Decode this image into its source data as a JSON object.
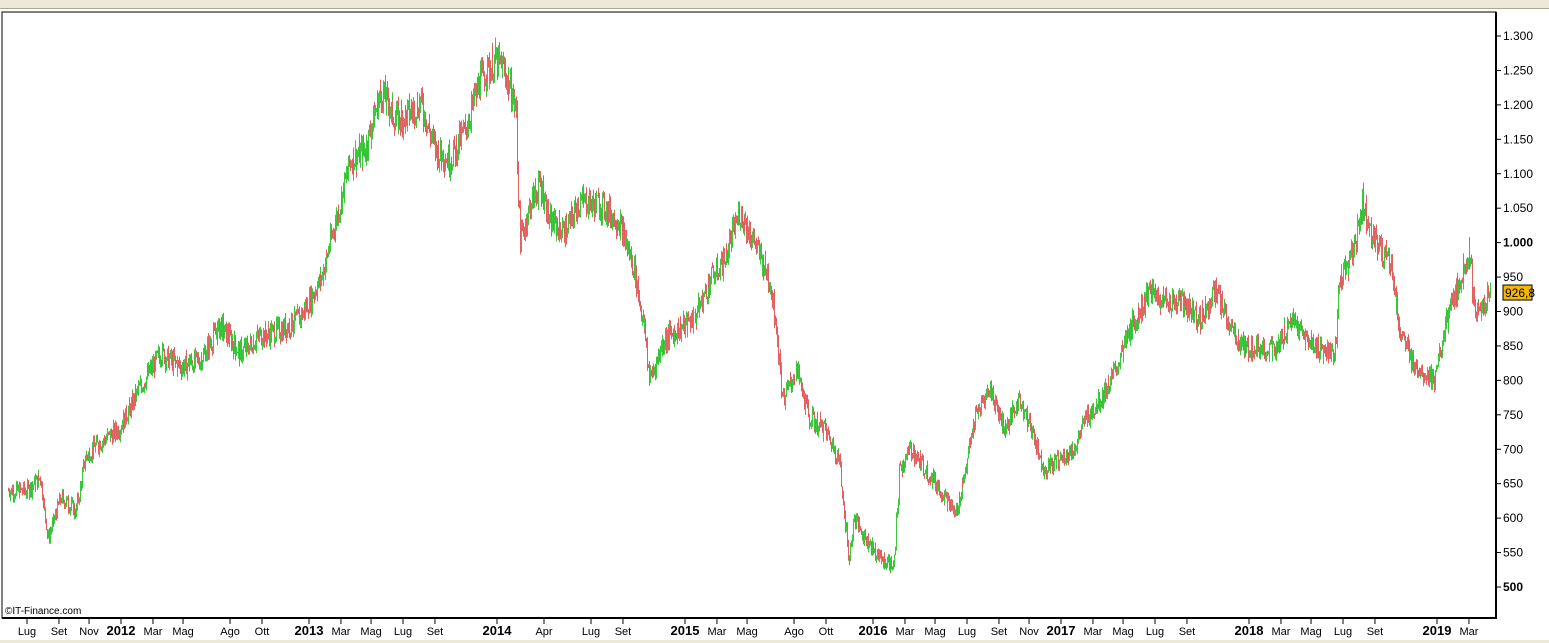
{
  "chart_data": {
    "type": "ohlc",
    "watermark": "©IT-Finance.com",
    "last_price_label": "926,8",
    "last_price": 926.8,
    "colors": {
      "up": "#3cc83c",
      "down": "#e06060",
      "badge": "#f5b800",
      "axis": "#000000"
    },
    "ylim": [
      460,
      1335
    ],
    "xlim": [
      2011.37,
      2019.32
    ],
    "y_ticks": [
      {
        "value": 1300,
        "label": "1.300",
        "bold": false
      },
      {
        "value": 1250,
        "label": "1.250",
        "bold": false
      },
      {
        "value": 1200,
        "label": "1.200",
        "bold": false
      },
      {
        "value": 1150,
        "label": "1.150",
        "bold": false
      },
      {
        "value": 1100,
        "label": "1.100",
        "bold": false
      },
      {
        "value": 1050,
        "label": "1.050",
        "bold": false
      },
      {
        "value": 1000,
        "label": "1.000",
        "bold": true
      },
      {
        "value": 950,
        "label": "950",
        "bold": false
      },
      {
        "value": 900,
        "label": "900",
        "bold": false
      },
      {
        "value": 850,
        "label": "850",
        "bold": false
      },
      {
        "value": 800,
        "label": "800",
        "bold": false
      },
      {
        "value": 750,
        "label": "750",
        "bold": false
      },
      {
        "value": 700,
        "label": "700",
        "bold": false
      },
      {
        "value": 650,
        "label": "650",
        "bold": false
      },
      {
        "value": 600,
        "label": "600",
        "bold": false
      },
      {
        "value": 550,
        "label": "550",
        "bold": false
      },
      {
        "value": 500,
        "label": "500",
        "bold": true
      }
    ],
    "x_ticks": [
      {
        "t": 2011.5,
        "label": "Lug"
      },
      {
        "t": 2011.67,
        "label": "Set"
      },
      {
        "t": 2011.83,
        "label": "Nov"
      },
      {
        "t": 2012.0,
        "label": "2012",
        "year": true
      },
      {
        "t": 2012.17,
        "label": "Mar"
      },
      {
        "t": 2012.33,
        "label": "Mag"
      },
      {
        "t": 2012.58,
        "label": "Ago"
      },
      {
        "t": 2012.75,
        "label": "Ott"
      },
      {
        "t": 2013.0,
        "label": "2013",
        "year": true
      },
      {
        "t": 2013.17,
        "label": "Mar"
      },
      {
        "t": 2013.33,
        "label": "Mag"
      },
      {
        "t": 2013.5,
        "label": "Lug"
      },
      {
        "t": 2013.67,
        "label": "Set"
      },
      {
        "t": 2014.0,
        "label": "2014",
        "year": true
      },
      {
        "t": 2014.25,
        "label": "Apr"
      },
      {
        "t": 2014.5,
        "label": "Lug"
      },
      {
        "t": 2014.67,
        "label": "Set"
      },
      {
        "t": 2015.0,
        "label": "2015",
        "year": true
      },
      {
        "t": 2015.17,
        "label": "Mar"
      },
      {
        "t": 2015.33,
        "label": "Mag"
      },
      {
        "t": 2015.58,
        "label": "Ago"
      },
      {
        "t": 2015.75,
        "label": "Ott"
      },
      {
        "t": 2016.0,
        "label": "2016",
        "year": true
      },
      {
        "t": 2016.17,
        "label": "Mar"
      },
      {
        "t": 2016.33,
        "label": "Mag"
      },
      {
        "t": 2016.5,
        "label": "Lug"
      },
      {
        "t": 2016.67,
        "label": "Set"
      },
      {
        "t": 2016.83,
        "label": "Nov"
      },
      {
        "t": 2017.0,
        "label": "2017",
        "year": true
      },
      {
        "t": 2017.17,
        "label": "Mar"
      },
      {
        "t": 2017.33,
        "label": "Mag"
      },
      {
        "t": 2017.5,
        "label": "Lug"
      },
      {
        "t": 2017.67,
        "label": "Set"
      },
      {
        "t": 2018.0,
        "label": "2018",
        "year": true
      },
      {
        "t": 2018.17,
        "label": "Mar"
      },
      {
        "t": 2018.33,
        "label": "Mag"
      },
      {
        "t": 2018.5,
        "label": "Lug"
      },
      {
        "t": 2018.67,
        "label": "Set"
      },
      {
        "t": 2019.0,
        "label": "2019",
        "year": true
      },
      {
        "t": 2019.17,
        "label": "Mar"
      }
    ],
    "series": {
      "t": [
        2011.4,
        2011.5,
        2011.57,
        2011.61,
        2011.68,
        2011.76,
        2011.81,
        2011.89,
        2011.99,
        2012.1,
        2012.21,
        2012.31,
        2012.42,
        2012.53,
        2012.63,
        2012.74,
        2012.85,
        2012.95,
        2013.06,
        2013.14,
        2013.22,
        2013.3,
        2013.38,
        2013.46,
        2013.54,
        2013.59,
        2013.67,
        2013.75,
        2013.83,
        2013.91,
        2013.99,
        2014.04,
        2014.1,
        2014.12,
        2014.18,
        2014.23,
        2014.28,
        2014.36,
        2014.44,
        2014.55,
        2014.65,
        2014.73,
        2014.79,
        2014.81,
        2014.89,
        2014.97,
        2015.05,
        2015.13,
        2015.21,
        2015.29,
        2015.37,
        2015.45,
        2015.48,
        2015.52,
        2015.59,
        2015.66,
        2015.74,
        2015.82,
        2015.87,
        2015.9,
        2015.96,
        2016.04,
        2016.11,
        2016.14,
        2016.2,
        2016.28,
        2016.36,
        2016.44,
        2016.49,
        2016.54,
        2016.62,
        2016.7,
        2016.78,
        2016.86,
        2016.91,
        2016.99,
        2017.07,
        2017.13,
        2017.21,
        2017.29,
        2017.37,
        2017.47,
        2017.55,
        2017.63,
        2017.74,
        2017.82,
        2017.9,
        2017.98,
        2018.06,
        2018.14,
        2018.22,
        2018.3,
        2018.38,
        2018.46,
        2018.48,
        2018.56,
        2018.6,
        2018.67,
        2018.75,
        2018.8,
        2018.86,
        2018.91,
        2018.99,
        2019.04,
        2019.12,
        2019.17,
        2019.2,
        2019.28
      ],
      "close": [
        640,
        640,
        660,
        570,
        630,
        610,
        690,
        710,
        730,
        790,
        840,
        820,
        830,
        880,
        840,
        865,
        873,
        890,
        945,
        1030,
        1120,
        1135,
        1220,
        1178,
        1190,
        1205,
        1135,
        1120,
        1165,
        1235,
        1265,
        1250,
        1190,
        1000,
        1060,
        1085,
        1030,
        1015,
        1060,
        1055,
        1030,
        960,
        860,
        800,
        860,
        875,
        890,
        945,
        975,
        1045,
        1000,
        945,
        890,
        772,
        815,
        745,
        730,
        685,
        540,
        600,
        570,
        540,
        530,
        670,
        700,
        670,
        640,
        605,
        670,
        745,
        790,
        730,
        772,
        715,
        670,
        685,
        700,
        745,
        772,
        815,
        875,
        930,
        915,
        915,
        890,
        930,
        875,
        845,
        850,
        840,
        890,
        860,
        845,
        840,
        945,
        990,
        1060,
        1000,
        975,
        875,
        830,
        815,
        800,
        875,
        945,
        990,
        890,
        925
      ]
    }
  }
}
